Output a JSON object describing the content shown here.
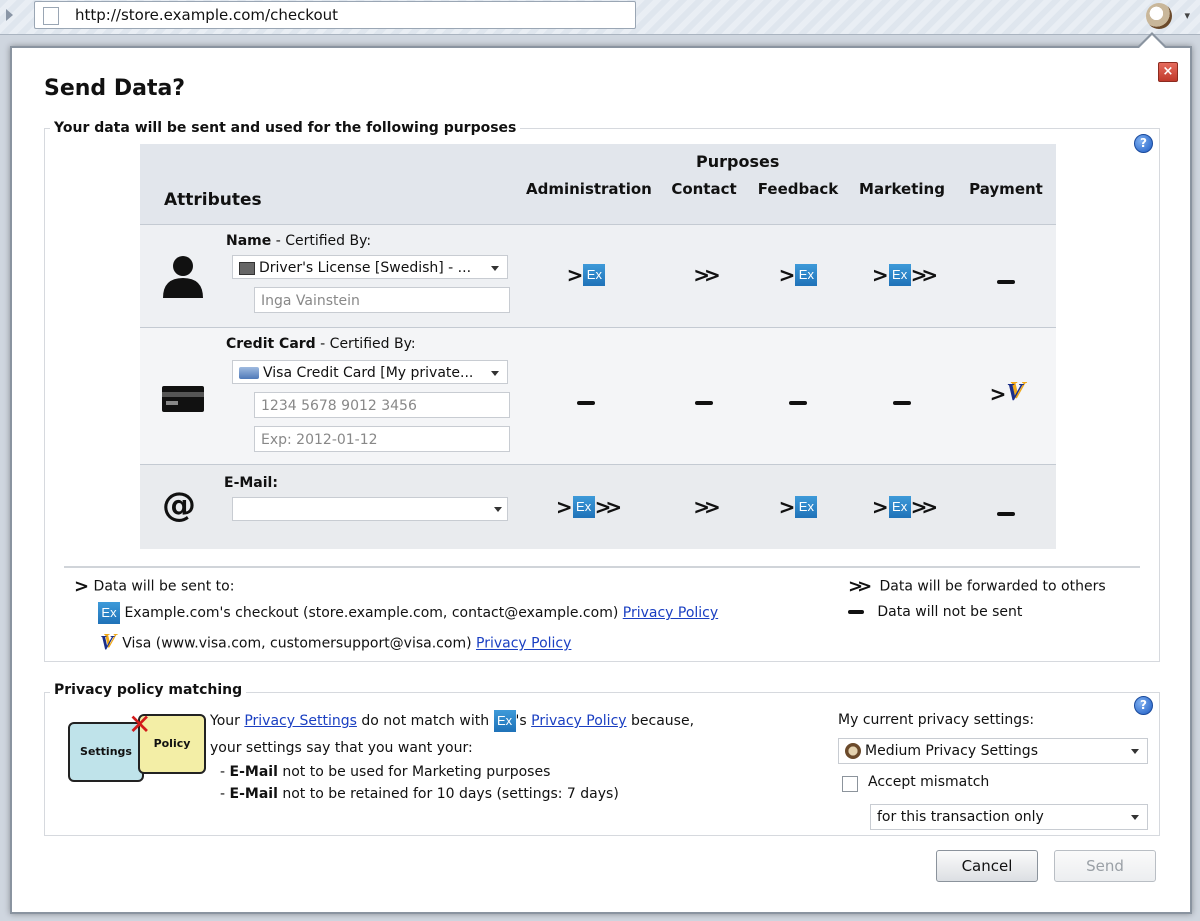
{
  "browser": {
    "url": "http://store.example.com/checkout"
  },
  "dialog": {
    "title": "Send Data?",
    "close_label": "×",
    "purposes_section": {
      "legend": "Your data will be sent and used for the following purposes",
      "help_label": "?",
      "table": {
        "purposes_header": "Purposes",
        "attributes_header": "Attributes",
        "columns": [
          "Administration",
          "Contact",
          "Feedback",
          "Marketing",
          "Payment"
        ],
        "rows": [
          {
            "name_label": "Name",
            "certified_label": " - Certified By:",
            "select_value": "Driver's License [Swedish] - ...",
            "inputs": [
              "Inga Vainstein"
            ],
            "marks": [
              "send-ex",
              "forward",
              "send-ex",
              "send-ex-forward",
              "none"
            ]
          },
          {
            "name_label": "Credit Card",
            "certified_label": " - Certified By:",
            "select_value": "Visa Credit Card [My private...",
            "inputs": [
              "1234 5678 9012 3456",
              "Exp: 2012-01-12"
            ],
            "marks": [
              "none",
              "none",
              "none",
              "none",
              "send-visa"
            ]
          },
          {
            "name_label": "E-Mail:",
            "certified_label": "",
            "select_value": "",
            "inputs": [],
            "marks": [
              "send-ex-forward",
              "forward",
              "send-ex",
              "send-ex-forward",
              "none"
            ]
          }
        ]
      },
      "legend_items": {
        "sent_to": "Data will be sent to:",
        "forwarded": "Data will be forwarded to others",
        "not_sent": "Data will not be sent",
        "ex_recipient": "Example.com's checkout (store.example.com, contact@example.com)",
        "visa_recipient": "Visa (www.visa.com, customersupport@visa.com)",
        "privacy_policy_link": "Privacy Policy"
      }
    },
    "privacy_section": {
      "legend": "Privacy policy matching",
      "help_label": "?",
      "puzzle_labels": {
        "settings": "Settings",
        "policy": "Policy"
      },
      "text_your": "Your",
      "privacy_settings_link": "Privacy Settings",
      "text_do_not_match": "do not match with",
      "text_apostrophe_s": "'s",
      "privacy_policy_link": "Privacy Policy",
      "text_because": "because,",
      "text_settings_say": "your settings say that you want your:",
      "reasons": [
        {
          "bold": "E-Mail",
          "rest": " not to be used for Marketing purposes"
        },
        {
          "bold": "E-Mail",
          "rest": " not to be retained for 10 days (settings: 7 days)"
        }
      ],
      "current_settings_label": "My current privacy settings:",
      "current_settings_value": "Medium Privacy Settings",
      "accept_mismatch_label": "Accept mismatch",
      "accept_mismatch_checked": false,
      "scope_value": "for this transaction only"
    },
    "buttons": {
      "cancel": "Cancel",
      "send": "Send"
    }
  },
  "logos": {
    "ex": "Ex",
    "visa": "V"
  },
  "colors": {
    "link": "#1a3fc2",
    "ex_logo": "#2b86c9",
    "close": "#c0392b"
  }
}
